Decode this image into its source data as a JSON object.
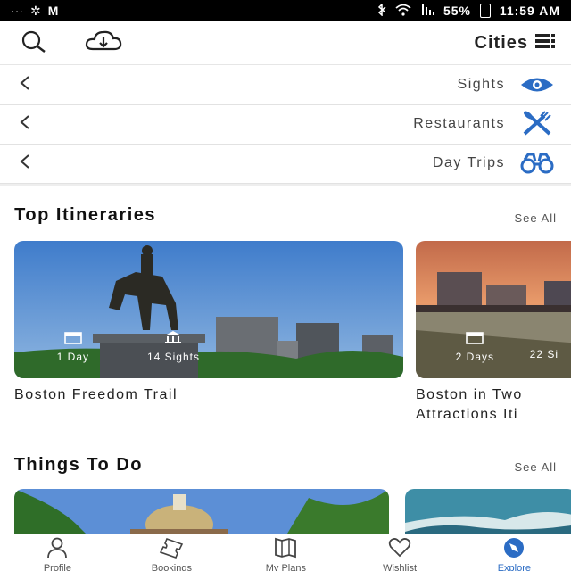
{
  "status_bar": {
    "time": "11:59 AM",
    "battery": "55%"
  },
  "header": {
    "title": "Cities",
    "download_icon": "cloud-download-icon",
    "search_icon": "search-icon"
  },
  "categories": [
    {
      "label": "Sights",
      "icon": "eye-icon"
    },
    {
      "label": "Restaurants",
      "icon": "utensils-icon"
    },
    {
      "label": "Day Trips",
      "icon": "binoculars-icon"
    }
  ],
  "itineraries": {
    "title": "Top Itineraries",
    "see_all": "See All",
    "cards": [
      {
        "title": "Boston Freedom Trail",
        "days": "1 Day",
        "sights": "14 Sights"
      },
      {
        "title": "Boston in Two Attractions Iti",
        "title_line1": "Boston in Two",
        "title_line2": "Attractions Iti",
        "days": "2 Days",
        "sights": "22 Si"
      }
    ]
  },
  "things_to_do": {
    "title": "Things To Do",
    "see_all": "See All"
  },
  "bottom_nav": [
    {
      "label": "Explore",
      "icon": "compass-icon",
      "active": true
    },
    {
      "label": "Wishlist",
      "icon": "heart-icon",
      "active": false
    },
    {
      "label": "My Plans",
      "icon": "map-icon",
      "active": false
    },
    {
      "label": "Bookings",
      "icon": "ticket-icon",
      "active": false
    },
    {
      "label": "Profile",
      "icon": "person-icon",
      "active": false
    }
  ],
  "colors": {
    "accent": "#2b6cc4",
    "status_bar": "#000000"
  }
}
